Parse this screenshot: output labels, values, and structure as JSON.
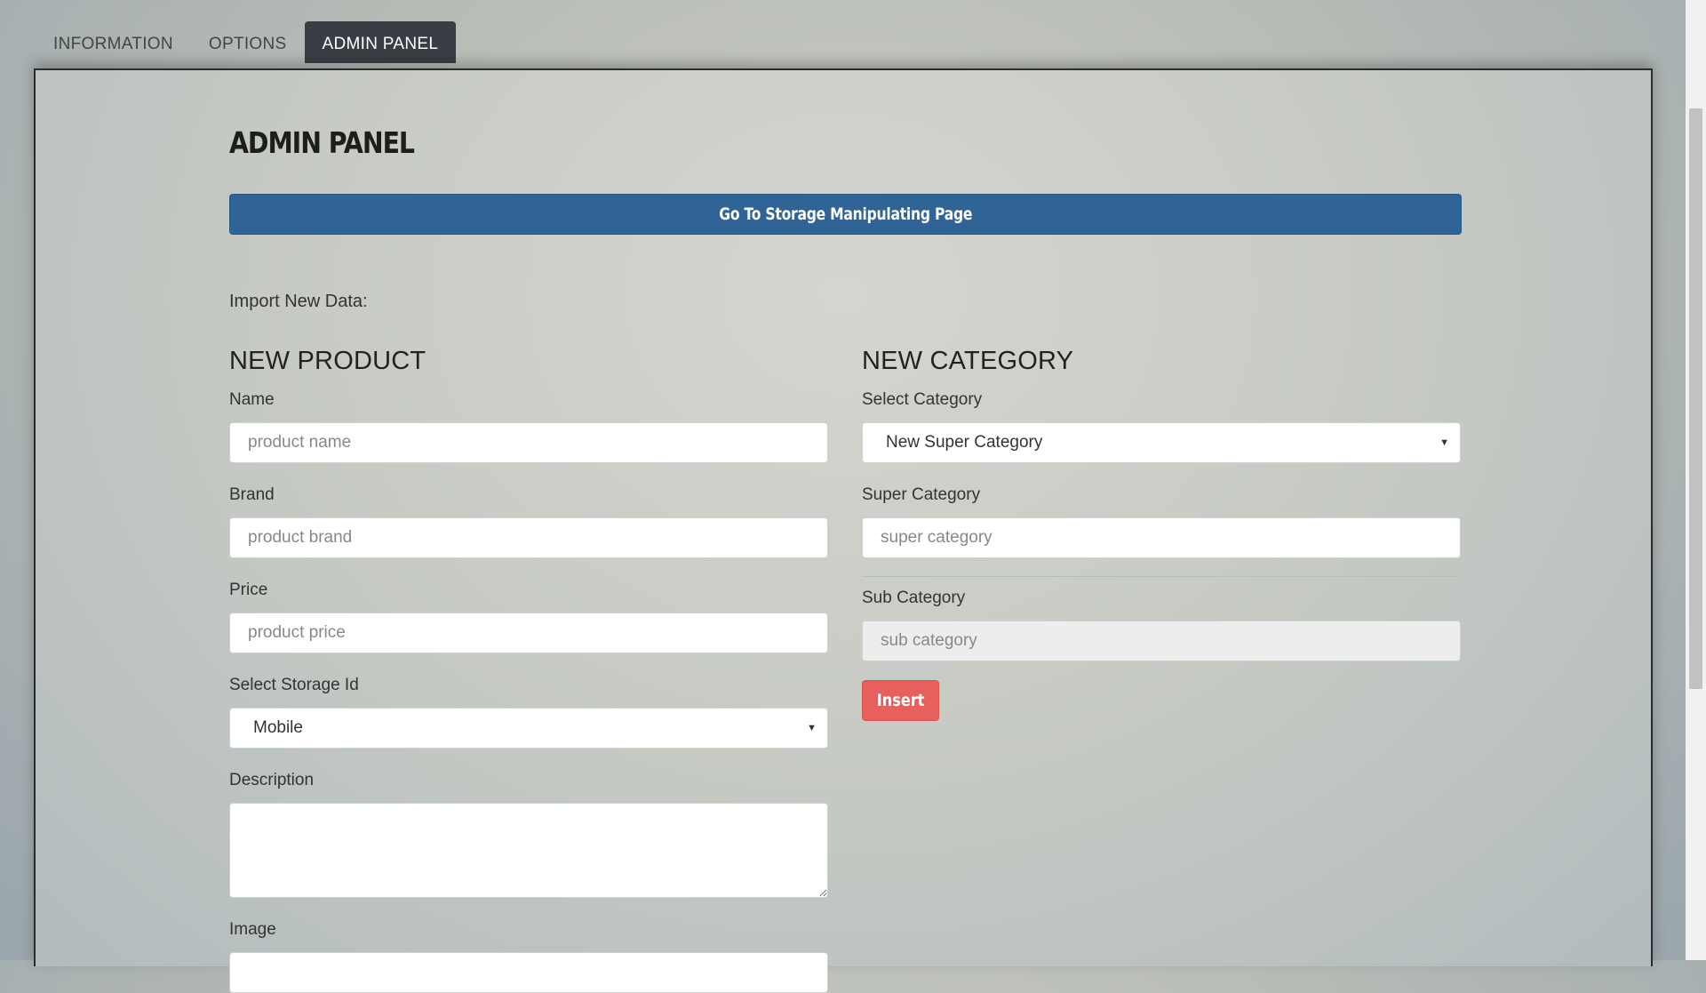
{
  "tabs": [
    {
      "label": "INFORMATION",
      "active": false
    },
    {
      "label": "OPTIONS",
      "active": false
    },
    {
      "label": "ADMIN PANEL",
      "active": true
    }
  ],
  "page_title": "ADMIN PANEL",
  "storage_button_label": "Go To Storage Manipulating Page",
  "import_label": "Import New Data:",
  "product": {
    "heading": "NEW PRODUCT",
    "name_label": "Name",
    "name_placeholder": "product name",
    "brand_label": "Brand",
    "brand_placeholder": "product brand",
    "price_label": "Price",
    "price_placeholder": "product price",
    "storage_label": "Select Storage Id",
    "storage_value": "Mobile",
    "description_label": "Description",
    "image_label": "Image"
  },
  "category": {
    "heading": "NEW CATEGORY",
    "select_label": "Select Category",
    "select_value": "New Super Category",
    "super_label": "Super Category",
    "super_placeholder": "super category",
    "sub_label": "Sub Category",
    "sub_placeholder": "sub category",
    "insert_label": "Insert"
  },
  "colors": {
    "primary_button": "#306497",
    "danger_button": "#e8605d",
    "active_tab": "#3a3e44"
  }
}
